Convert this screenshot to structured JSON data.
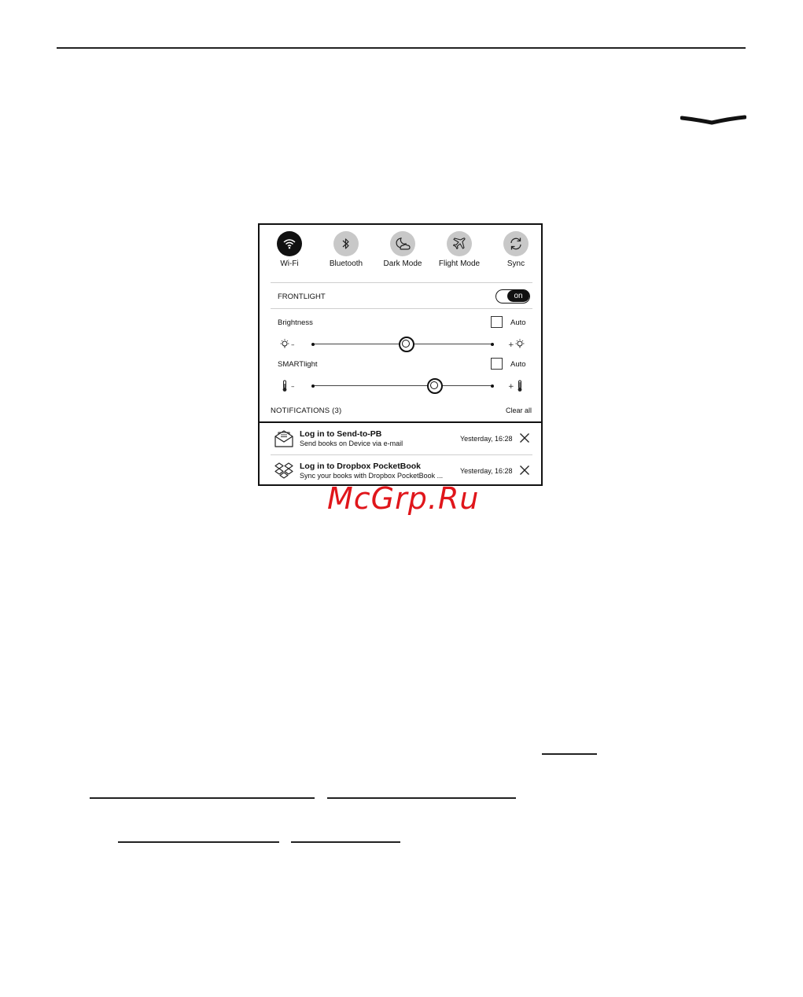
{
  "quick_toggles": [
    {
      "label": "Wi-Fi",
      "icon": "wifi-icon",
      "active": true
    },
    {
      "label": "Bluetooth",
      "icon": "bluetooth-icon",
      "active": false
    },
    {
      "label": "Dark Mode",
      "icon": "moon-icon",
      "active": false
    },
    {
      "label": "Flight Mode",
      "icon": "airplane-icon",
      "active": false
    },
    {
      "label": "Sync",
      "icon": "sync-icon",
      "active": false
    }
  ],
  "frontlight": {
    "label": "FRONTLIGHT",
    "switch_label": "on",
    "on": true
  },
  "brightness": {
    "label": "Brightness",
    "auto_label": "Auto",
    "auto_checked": false,
    "minus": "–",
    "plus": "+",
    "level": 0.52
  },
  "smartlight": {
    "label": "SMARTlight",
    "auto_label": "Auto",
    "auto_checked": false,
    "minus": "–",
    "plus": "+",
    "level": 0.68
  },
  "notifications": {
    "header": "NOTIFICATIONS (3)",
    "clear_all": "Clear all",
    "items": [
      {
        "icon": "envelope-icon",
        "title": "Log in to Send-to-PB",
        "subtitle": "Send books on Device via e-mail",
        "time": "Yesterday, 16:28"
      },
      {
        "icon": "dropbox-icon",
        "title": "Log in to Dropbox PocketBook",
        "subtitle": "Sync your books with Dropbox PocketBook ...",
        "time": "Yesterday, 16:28"
      }
    ]
  },
  "watermark": "McGrp.Ru",
  "colors": {
    "watermark": "#e0161b",
    "toggle_active": "#111111",
    "toggle_inactive": "#c8c8c8"
  }
}
